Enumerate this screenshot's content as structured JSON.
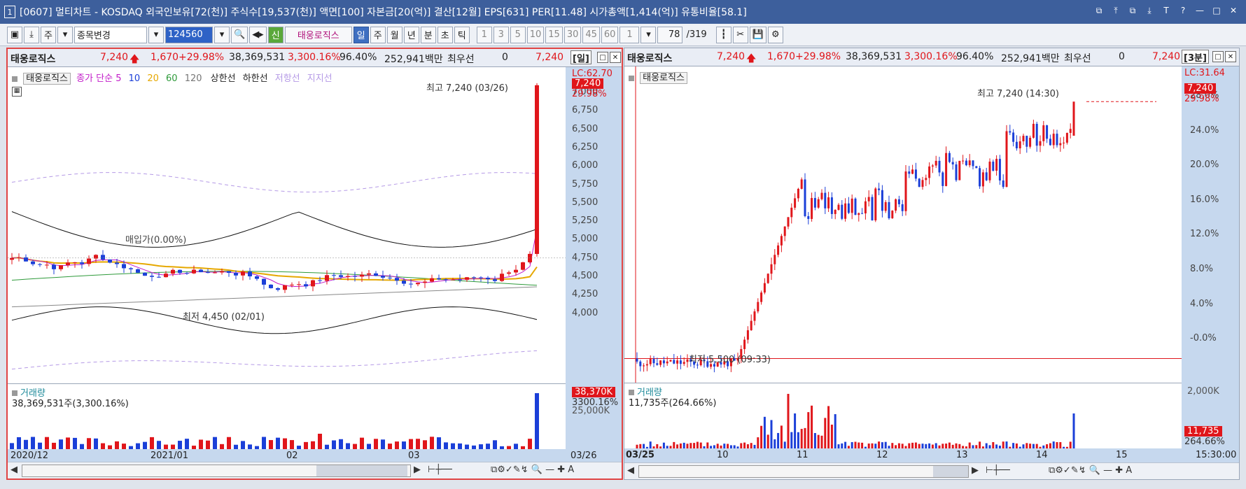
{
  "window": {
    "num": "1",
    "title": "[0607] 멀티차트 - KOSDAQ 외국인보유[72(천)] 주식수[19,537(천)] 액면[100] 자본금[20(억)] 결산[12월] EPS[631] PER[11.48] 시가총액[1,414(억)] 유통비율[58.1]",
    "buttons": [
      "⧉",
      "⤒",
      "⧉",
      "⤓",
      "T",
      "?",
      "—",
      "□",
      "✕"
    ]
  },
  "toolbar": {
    "type": "주",
    "mode": "종목변경",
    "code": "124560",
    "stock": "태웅로직스",
    "stock_tag": "신",
    "periods": [
      "일",
      "주",
      "월",
      "년",
      "분",
      "초",
      "틱"
    ],
    "selected": "일",
    "minutes": [
      "1",
      "3",
      "5",
      "10",
      "15",
      "30",
      "45",
      "60"
    ],
    "count": "1",
    "page": "78",
    "total": "/319"
  },
  "left": {
    "header": {
      "name": "태웅로직스",
      "price": "7,240",
      "arrow": "🡅",
      "change": "1,670",
      "pct": "+29.98%",
      "volume": "38,369,531",
      "vol_pct": "3,300.16%",
      "ratio": "96.40%",
      "amount": "252,941백만",
      "tag": "최우선",
      "bid": "0",
      "ask": "7,240",
      "period": "[일]"
    },
    "legend": {
      "name": "태웅로직스",
      "ma_label": "종가 단순",
      "ma": [
        "5",
        "10",
        "20",
        "60",
        "120"
      ],
      "upper": "상한선",
      "lower": "하한선",
      "resist": "저항선",
      "support": "지지선"
    },
    "lc": "LC:62.70",
    "last_price": "7,240",
    "last_pct": "29.98%",
    "high_label": "최고 7,240 (03/26)",
    "low_label": "최저 4,450 (02/01)",
    "base_label": "매입가(0.00%)",
    "ticks": [
      "7,000",
      "6,750",
      "6,500",
      "6,250",
      "6,000",
      "5,750",
      "5,500",
      "5,250",
      "5,000",
      "4,750",
      "4,500",
      "4,250",
      "4,000"
    ],
    "volume": {
      "title": "거래량",
      "value": "38,369,531주(3,300.16%)",
      "badge": "38,370K",
      "badge_pct": "3300.16%",
      "tick": "25,000K"
    },
    "dates": [
      "2020/12",
      "2021/01",
      "02",
      "03",
      "03/26"
    ]
  },
  "right": {
    "header": {
      "name": "태웅로직스",
      "price": "7,240",
      "arrow": "🡅",
      "change": "1,670",
      "pct": "+29.98%",
      "volume": "38,369,531",
      "vol_pct": "3,300.16%",
      "ratio": "96.40%",
      "amount": "252,941백만",
      "tag": "최우선",
      "bid": "0",
      "ask": "7,240",
      "period": "[3분]"
    },
    "legend": {
      "name": "태웅로직스"
    },
    "lc": "LC:31.64",
    "last_price": "7,240",
    "last_pct": "29.98%",
    "high_label": "최고 7,240 (14:30)",
    "low_label": "최저 5,500 (09:33)",
    "ticks": [
      "28.0%",
      "24.0%",
      "20.0%",
      "16.0%",
      "12.0%",
      "8.0%",
      "4.0%",
      "-0.0%"
    ],
    "volume": {
      "title": "거래량",
      "value": "11,735주(264.66%)",
      "badge": "11,735",
      "badge_pct": "264.66%",
      "tick": "2,000K"
    },
    "dates": [
      "03/25",
      "10",
      "11",
      "12",
      "13",
      "14",
      "15",
      "15:30:00"
    ]
  },
  "colors": {
    "up": "#e0161b",
    "down": "#1b3fd8",
    "axis": "#c6d8ee",
    "ma5": "#c21cc9",
    "ma10": "#1b3fd8",
    "ma20": "#e6a800",
    "ma60": "#2e9a3a",
    "ma120": "#777777"
  },
  "chart_data": [
    {
      "type": "candlestick",
      "title": "태웅로직스 일봉",
      "x": [
        "2020/12",
        "2021/01",
        "02",
        "03",
        "03/26"
      ],
      "high": 7240,
      "high_date": "03/26",
      "low": 4450,
      "low_date": "02/01",
      "last": 7240,
      "ylim": [
        4000,
        7200
      ]
    },
    {
      "type": "candlestick",
      "title": "태웅로직스 3분봉",
      "x": [
        "03/25",
        "10",
        "11",
        "12",
        "13",
        "14",
        "15"
      ],
      "high": 7240,
      "high_time": "14:30",
      "low": 5500,
      "low_time": "09:33",
      "last": 7240,
      "ylim_pct": [
        -0.02,
        0.3
      ]
    }
  ]
}
